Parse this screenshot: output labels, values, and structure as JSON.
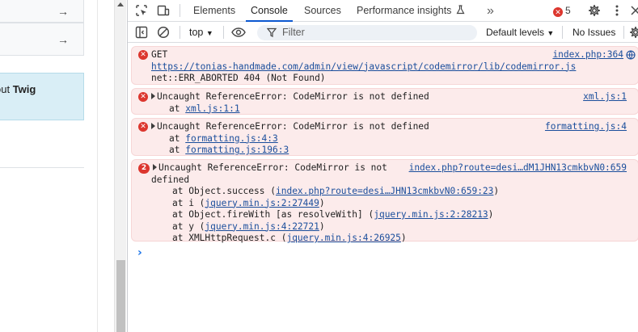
{
  "page": {
    "alert_prefix": "out ",
    "alert_bold": "Twig",
    "row1_arrow": "→",
    "row2_arrow": "→"
  },
  "devtools": {
    "tabs": [
      {
        "label": "Elements",
        "active": false
      },
      {
        "label": "Console",
        "active": true
      },
      {
        "label": "Sources",
        "active": false
      },
      {
        "label": "Performance insights",
        "active": false
      }
    ],
    "more_tabs": "»",
    "error_count": "5",
    "toolbar": {
      "context": "top",
      "filter_placeholder": "Filter",
      "levels": "Default levels",
      "issues": "No Issues"
    }
  },
  "console": {
    "messages": [
      {
        "method": "GET",
        "url": "https://tonias-handmade.com/admin/view/javascript/codemirror/lib/codemirror.js",
        "error": "net::ERR_ABORTED 404 (Not Found)",
        "source": "index.php:364"
      },
      {
        "text": "Uncaught ReferenceError: CodeMirror is not defined",
        "at_label": "at",
        "stack": [
          "xml.js:1:1"
        ],
        "source": "xml.js:1"
      },
      {
        "text": "Uncaught ReferenceError: CodeMirror is not defined",
        "at_label": "at",
        "stack": [
          "formatting.js:4:3",
          "formatting.js:196:3"
        ],
        "source": "formatting.js:4"
      },
      {
        "count": "2",
        "text_line1": "Uncaught ReferenceError: CodeMirror is not",
        "text_line2": "defined",
        "source": "index.php?route=desi…dM1JHN13cmkbvN0:659",
        "stack": [
          {
            "prefix": "at Object.success (",
            "link": "index.php?route=desi…JHN13cmkbvN0:659:23",
            "suffix": ")"
          },
          {
            "prefix": "at i (",
            "link": "jquery.min.js:2:27449",
            "suffix": ")"
          },
          {
            "prefix": "at Object.fireWith [as resolveWith] (",
            "link": "jquery.min.js:2:28213",
            "suffix": ")"
          },
          {
            "prefix": "at y (",
            "link": "jquery.min.js:4:22721",
            "suffix": ")"
          },
          {
            "prefix": "at XMLHttpRequest.c (",
            "link": "jquery.min.js:4:26925",
            "suffix": ")"
          }
        ]
      }
    ],
    "prompt": "›"
  },
  "colors": {
    "error_bg": "#fcebeb",
    "error_red": "#dc362e",
    "link": "#1a4e9c",
    "accent": "#0b57d0"
  }
}
